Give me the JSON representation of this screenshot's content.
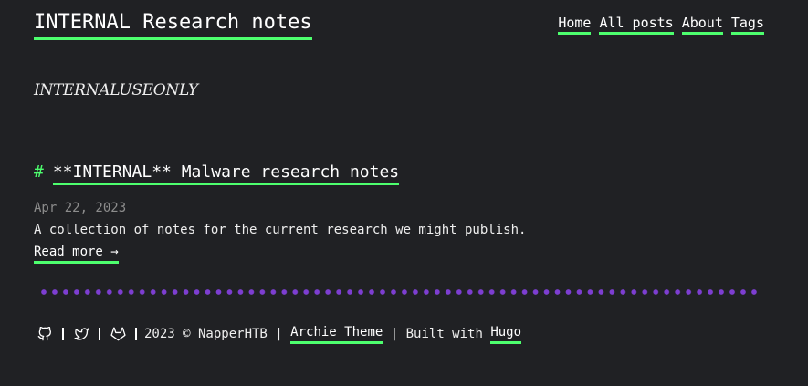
{
  "header": {
    "site_title": "INTERNAL Research notes",
    "nav": [
      {
        "label": "Home"
      },
      {
        "label": "All posts"
      },
      {
        "label": "About"
      },
      {
        "label": "Tags"
      }
    ]
  },
  "tagline": "INTERNALUSEONLY",
  "post": {
    "hash": "#",
    "title": "**INTERNAL** Malware research notes",
    "date": "Apr 22, 2023",
    "summary": "A collection of notes for the current research we might publish.",
    "read_more": "Read more →"
  },
  "footer": {
    "icons": [
      "github-icon",
      "twitter-icon",
      "gitlab-icon"
    ],
    "copyright": "2023 © NapperHTB | ",
    "theme_link": "Archie Theme",
    "built_with": " | Built with ",
    "hugo_link": "Hugo"
  },
  "colors": {
    "background": "#202124",
    "accent_underline": "#4dff6e",
    "divider_dots": "#7d3ed1",
    "muted_text": "#8c8c8c"
  }
}
